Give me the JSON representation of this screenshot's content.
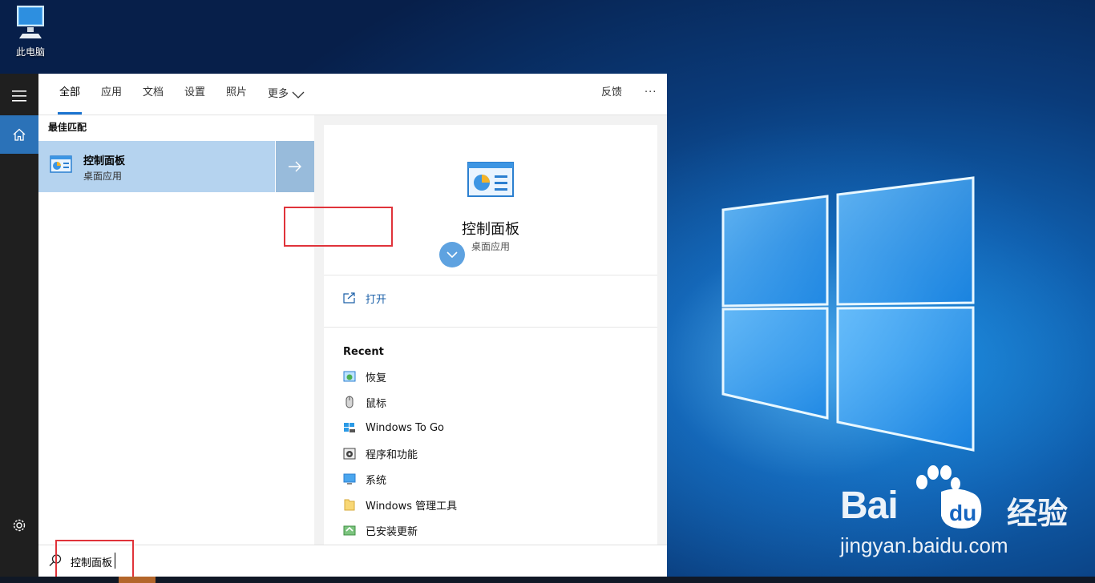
{
  "desktop": {
    "icon_label": "此电脑",
    "icon_name": "computer-icon"
  },
  "rail": {
    "menu_icon": "hamburger-menu-icon",
    "home_icon": "home-icon",
    "settings_icon": "gear-icon"
  },
  "tabs": {
    "all": "全部",
    "apps": "应用",
    "docs": "文档",
    "settings": "设置",
    "photos": "照片",
    "more": "更多",
    "feedback": "反馈",
    "ellipsis": "···"
  },
  "best_match": {
    "section_title": "最佳匹配",
    "title": "控制面板",
    "subtitle": "桌面应用"
  },
  "detail": {
    "title": "控制面板",
    "subtitle": "桌面应用",
    "open_label": "打开",
    "recent_title": "Recent",
    "recent_items": [
      {
        "label": "恢复",
        "icon": "recovery-icon"
      },
      {
        "label": "鼠标",
        "icon": "mouse-icon"
      },
      {
        "label": "Windows To Go",
        "icon": "windows-to-go-icon"
      },
      {
        "label": "程序和功能",
        "icon": "programs-features-icon"
      },
      {
        "label": "系统",
        "icon": "system-icon"
      },
      {
        "label": "Windows 管理工具",
        "icon": "admin-tools-folder-icon"
      },
      {
        "label": "已安装更新",
        "icon": "installed-updates-icon"
      }
    ]
  },
  "search": {
    "query": "控制面板"
  },
  "watermark": {
    "brand": "Bai",
    "brand_cn": "经验",
    "url": "jingyan.baidu.com"
  },
  "colors": {
    "accent": "#1a73d0",
    "selection": "#b5d3ef",
    "highlight_box": "#e0333a"
  }
}
